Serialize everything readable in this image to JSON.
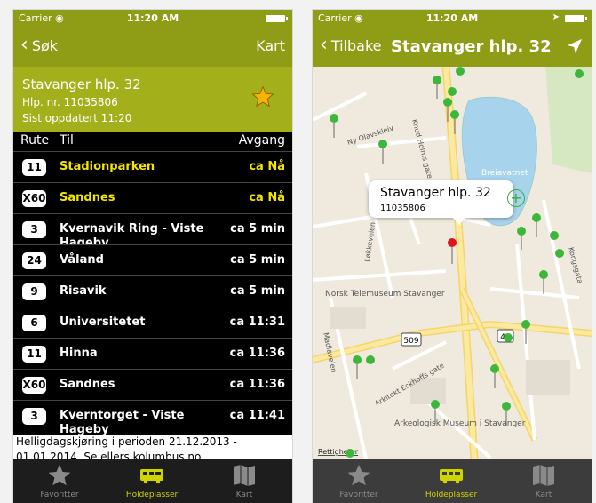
{
  "left": {
    "status": {
      "carrier": "Carrier ◉",
      "time": "11:20 AM"
    },
    "nav": {
      "back": "Søk",
      "right": "Kart"
    },
    "stop": {
      "name": "Stavanger hlp. 32",
      "number": "Hlp. nr. 11035806",
      "updated": "Sist oppdatert 11:20",
      "favorite_icon": "star-icon"
    },
    "columns": {
      "route": "Rute",
      "to": "Til",
      "departure": "Avgang"
    },
    "departures": [
      {
        "route": "11",
        "dest": "Stadionparken",
        "time": "ca Nå",
        "highlight": true
      },
      {
        "route": "X60",
        "dest": "Sandnes",
        "time": "ca Nå",
        "highlight": true
      },
      {
        "route": "3",
        "dest": "Kvernavik Ring - Viste Hageby",
        "time": "ca 5 min",
        "highlight": false
      },
      {
        "route": "24",
        "dest": "Våland",
        "time": "ca 5 min",
        "highlight": false
      },
      {
        "route": "9",
        "dest": "Risavik",
        "time": "ca 5 min",
        "highlight": false
      },
      {
        "route": "6",
        "dest": "Universitetet",
        "time": "ca 11:31",
        "highlight": false
      },
      {
        "route": "11",
        "dest": "Hinna",
        "time": "ca 11:36",
        "highlight": false
      },
      {
        "route": "X60",
        "dest": "Sandnes",
        "time": "ca 11:36",
        "highlight": false
      },
      {
        "route": "3",
        "dest": "Kverntorget - Viste Hageby",
        "time": "ca 11:41",
        "highlight": false
      }
    ],
    "notice": "Helligdagskjøring i perioden 21.12.2013 - 01.01.2014. Se ellers kolumbus.no.",
    "tabs": [
      {
        "label": "Favoritter",
        "icon": "star-icon"
      },
      {
        "label": "Holdeplasser",
        "icon": "bus-icon"
      },
      {
        "label": "Kart",
        "icon": "map-icon"
      }
    ]
  },
  "right": {
    "status": {
      "carrier": "Carrier ◉",
      "time": "11:20 AM"
    },
    "nav": {
      "back": "Tilbake",
      "title": "Stavanger hlp. 32"
    },
    "callout": {
      "name": "Stavanger hlp. 32",
      "number": "11035806"
    },
    "map_labels": [
      "Breiavatnet",
      "Norsk Telemuseum Stavanger",
      "Arkeologisk Museum i Stavanger",
      "Løkkeveien",
      "Ny Olavskleiv",
      "Knud Holms gate",
      "Arkitekt Eckhoffs gate",
      "Madlaveien",
      "Kongsgata",
      "Rettigheter",
      "509",
      "44"
    ],
    "tabs": [
      {
        "label": "Favoritter",
        "icon": "star-icon"
      },
      {
        "label": "Holdeplasser",
        "icon": "bus-icon"
      },
      {
        "label": "Kart",
        "icon": "map-icon"
      }
    ]
  },
  "colors": {
    "nav_green": "#8e9c16",
    "header_green": "#a3b01c",
    "highlight_yellow": "#f2e500",
    "pin_green": "#3cb73c",
    "pin_red": "#e0151b"
  }
}
